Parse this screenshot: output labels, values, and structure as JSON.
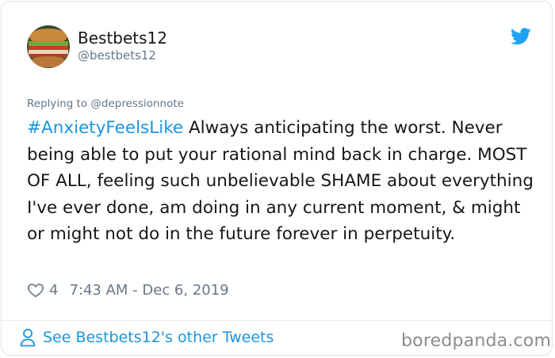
{
  "tweet": {
    "display_name": "Bestbets12",
    "handle": "@bestbets12",
    "reply_prefix": "Replying to ",
    "reply_to": "@depressionnote",
    "hashtag": "#AnxietyFeelsLike",
    "text": " Always anticipating the worst. Never being able to put your rational mind back in charge. MOST OF ALL, feeling such unbelievable SHAME about everything I've ever done, am doing in any current moment, & might or might not do in the future forever in perpetuity.",
    "like_count": "4",
    "timestamp": "7:43 AM - Dec 6, 2019"
  },
  "footer": {
    "see_more": "See Bestbets12's other Tweets",
    "watermark": "boredpanda.com"
  },
  "icons": {
    "brand": "twitter-bird-icon",
    "like": "heart-icon",
    "profile": "person-icon"
  },
  "colors": {
    "accent": "#1b95e0",
    "muted": "#657786",
    "text": "#14171a"
  }
}
